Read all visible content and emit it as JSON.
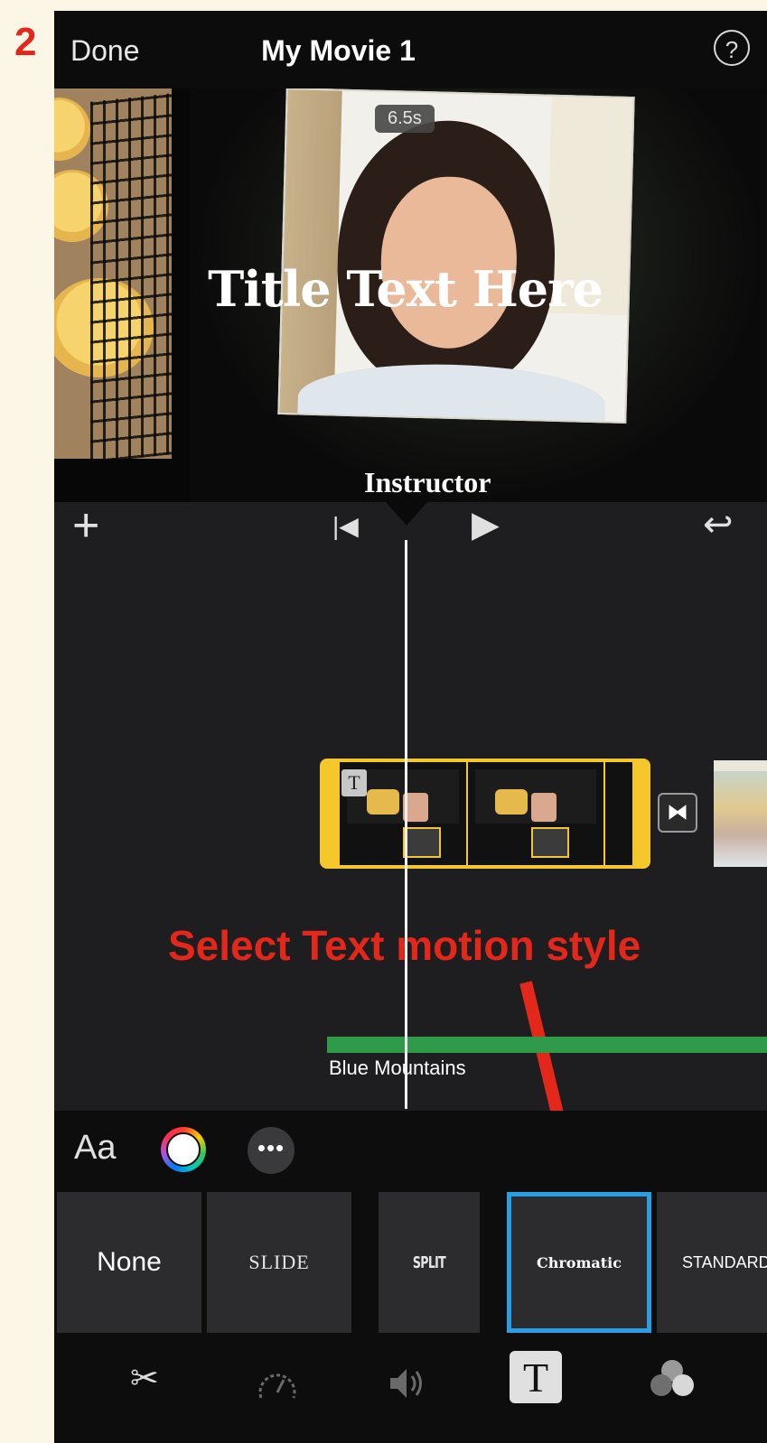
{
  "annotation": {
    "step_number": "2",
    "instruction": "Select Text motion style",
    "accent_color": "#e3271a"
  },
  "header": {
    "done_label": "Done",
    "project_title": "My Movie 1",
    "help_icon": "question-circle-icon"
  },
  "preview": {
    "duration": "6.5s",
    "overlay_title": "Title Text Here",
    "lower_text": "Instructor"
  },
  "playback": {
    "add_icon": "plus-icon",
    "skip_back_icon": "skip-to-start-icon",
    "play_icon": "play-icon",
    "undo_icon": "undo-icon"
  },
  "timeline": {
    "audio_track_label": "Blue Mountains",
    "title_badge": "T",
    "audio_color": "#2e9a4a",
    "clip_color": "#f5c72a"
  },
  "text_tools": {
    "font_label": "Aa",
    "more_label": "•••"
  },
  "title_styles": [
    {
      "label": "None",
      "selected": false
    },
    {
      "label": "SLIDE",
      "selected": false
    },
    {
      "label": "SPLIT",
      "selected": false
    },
    {
      "label": "Chromatic",
      "selected": true
    },
    {
      "label": "STANDARD",
      "selected": false
    }
  ],
  "bottom_tools": {
    "scissors_icon": "scissors-icon",
    "speed_icon": "speedometer-icon",
    "volume_icon": "volume-icon",
    "text_label": "T",
    "filters_icon": "filters-icon"
  },
  "selection_color": "#2a9ee4"
}
